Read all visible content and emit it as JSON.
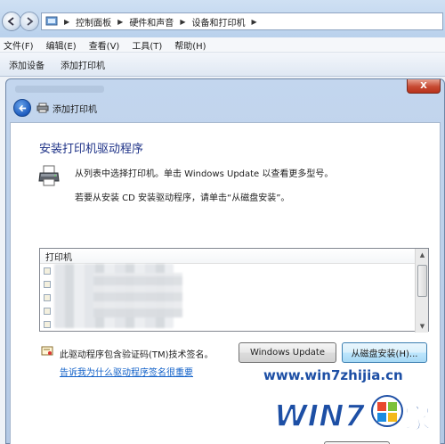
{
  "explorer": {
    "breadcrumb": [
      "控制面板",
      "硬件和声音",
      "设备和打印机"
    ],
    "menu": [
      "文件(F)",
      "编辑(E)",
      "查看(V)",
      "工具(T)",
      "帮助(H)"
    ],
    "commands": [
      "添加设备",
      "添加打印机"
    ]
  },
  "dialog": {
    "close_label": "X",
    "title": "添加打印机",
    "heading": "安装打印机驱动程序",
    "description_1": "从列表中选择打印机。单击 Windows Update 以查看更多型号。",
    "description_2": "若要从安装 CD 安装驱动程序，请单击“从磁盘安装”。",
    "list_header": "打印机",
    "signing_text": "此驱动程序包含验证码(TM)技术签名。",
    "signing_link": "告诉我为什么驱动程序签名很重要",
    "windows_update_button": "Windows Update",
    "have_disk_button": "从磁盘安装(H)..."
  },
  "watermark": {
    "url": "www.win7zhijia.cn",
    "logo_text": "WIN7",
    "logo_suffix": "家"
  },
  "colors": {
    "heading": "#1e3287",
    "link": "#1060c8",
    "chrome": "#c3d6ee"
  }
}
